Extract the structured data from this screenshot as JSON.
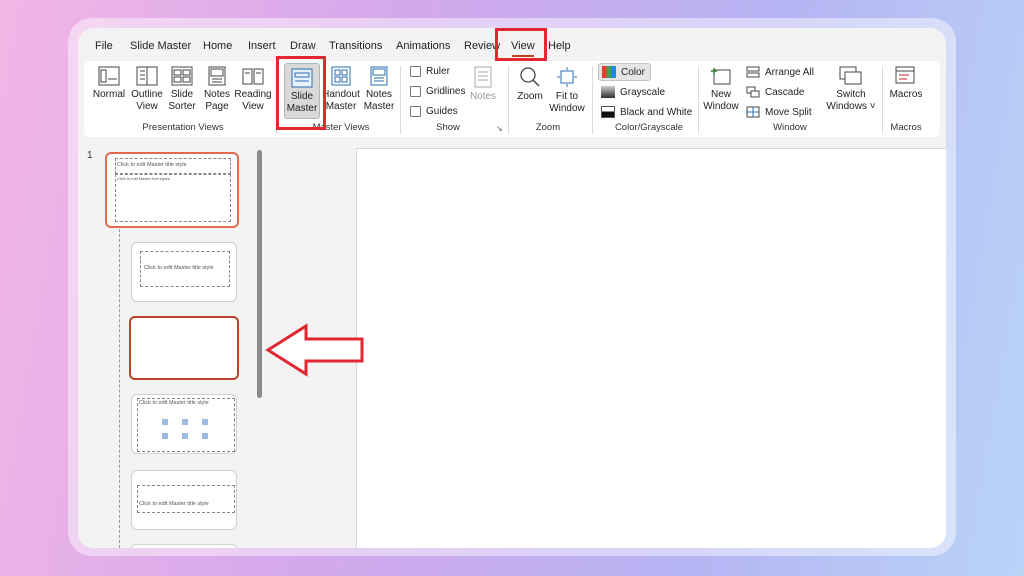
{
  "tabs": [
    "File",
    "Slide Master",
    "Home",
    "Insert",
    "Draw",
    "Transitions",
    "Animations",
    "Review",
    "View",
    "Help"
  ],
  "active_tab": "View",
  "ribbon": {
    "presentation_views": {
      "group_label": "Presentation Views",
      "buttons": [
        {
          "l1": "Normal",
          "l2": ""
        },
        {
          "l1": "Outline",
          "l2": "View"
        },
        {
          "l1": "Slide",
          "l2": "Sorter"
        },
        {
          "l1": "Notes",
          "l2": "Page"
        },
        {
          "l1": "Reading",
          "l2": "View"
        }
      ]
    },
    "master_views": {
      "group_label": "Master Views",
      "buttons": [
        {
          "l1": "Slide",
          "l2": "Master"
        },
        {
          "l1": "Handout",
          "l2": "Master"
        },
        {
          "l1": "Notes",
          "l2": "Master"
        }
      ]
    },
    "show": {
      "group_label": "Show",
      "checks": [
        "Ruler",
        "Gridlines",
        "Guides"
      ],
      "notes_label": "Notes"
    },
    "zoom": {
      "group_label": "Zoom",
      "zoom_label": "Zoom",
      "fit_l1": "Fit to",
      "fit_l2": "Window"
    },
    "color": {
      "group_label": "Color/Grayscale",
      "items": [
        "Color",
        "Grayscale",
        "Black and White"
      ]
    },
    "window": {
      "group_label": "Window",
      "new_l1": "New",
      "new_l2": "Window",
      "items": [
        "Arrange All",
        "Cascade",
        "Move Split"
      ],
      "switch_l1": "Switch",
      "switch_l2": "Windows"
    },
    "macros": {
      "group_label": "Macros",
      "label": "Macros"
    }
  },
  "slides": {
    "master_number": "1",
    "thumb_title": "Click to edit Master title style",
    "thumb_text": "Click to edit Master text styles"
  },
  "colors": {
    "accent": "#c43e1c",
    "highlight_red": "#e3262f"
  }
}
